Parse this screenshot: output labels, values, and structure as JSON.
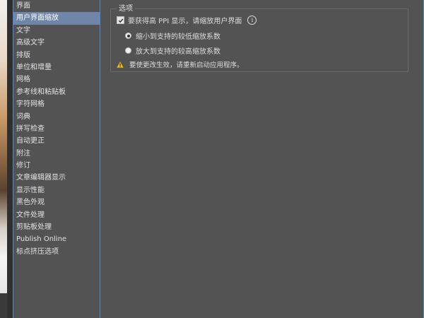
{
  "categories": [
    {
      "label": "界面",
      "selected": false
    },
    {
      "label": "用户界面缩放",
      "selected": true
    },
    {
      "label": "文字",
      "selected": false
    },
    {
      "label": "高级文字",
      "selected": false
    },
    {
      "label": "排版",
      "selected": false
    },
    {
      "label": "单位和增量",
      "selected": false
    },
    {
      "label": "网格",
      "selected": false
    },
    {
      "label": "参考线和粘贴板",
      "selected": false
    },
    {
      "label": "字符网格",
      "selected": false
    },
    {
      "label": "词典",
      "selected": false
    },
    {
      "label": "拼写检查",
      "selected": false
    },
    {
      "label": "自动更正",
      "selected": false
    },
    {
      "label": "附注",
      "selected": false
    },
    {
      "label": "修订",
      "selected": false
    },
    {
      "label": "文章编辑器显示",
      "selected": false
    },
    {
      "label": "显示性能",
      "selected": false
    },
    {
      "label": "黑色外观",
      "selected": false
    },
    {
      "label": "文件处理",
      "selected": false
    },
    {
      "label": "剪贴板处理",
      "selected": false
    },
    {
      "label": "Publish Online",
      "selected": false
    },
    {
      "label": "标点挤压选项",
      "selected": false
    }
  ],
  "options": {
    "group_title": "选项",
    "checkbox_label": "要获得高 PPI 显示，请缩放用户界面",
    "checkbox_checked": true,
    "info_icon": "i",
    "radio_smaller": {
      "label": "缩小到支持的较低缩放系数",
      "selected": true
    },
    "radio_larger": {
      "label": "放大到支持的较高缩放系数",
      "selected": false
    },
    "warning_text": "要使更改生效，请重新启动应用程序。"
  },
  "colors": {
    "panel_bg": "#535353",
    "selection": "#6f86a8",
    "focus_border": "#4a8fd6",
    "warning": "#f0c000"
  }
}
